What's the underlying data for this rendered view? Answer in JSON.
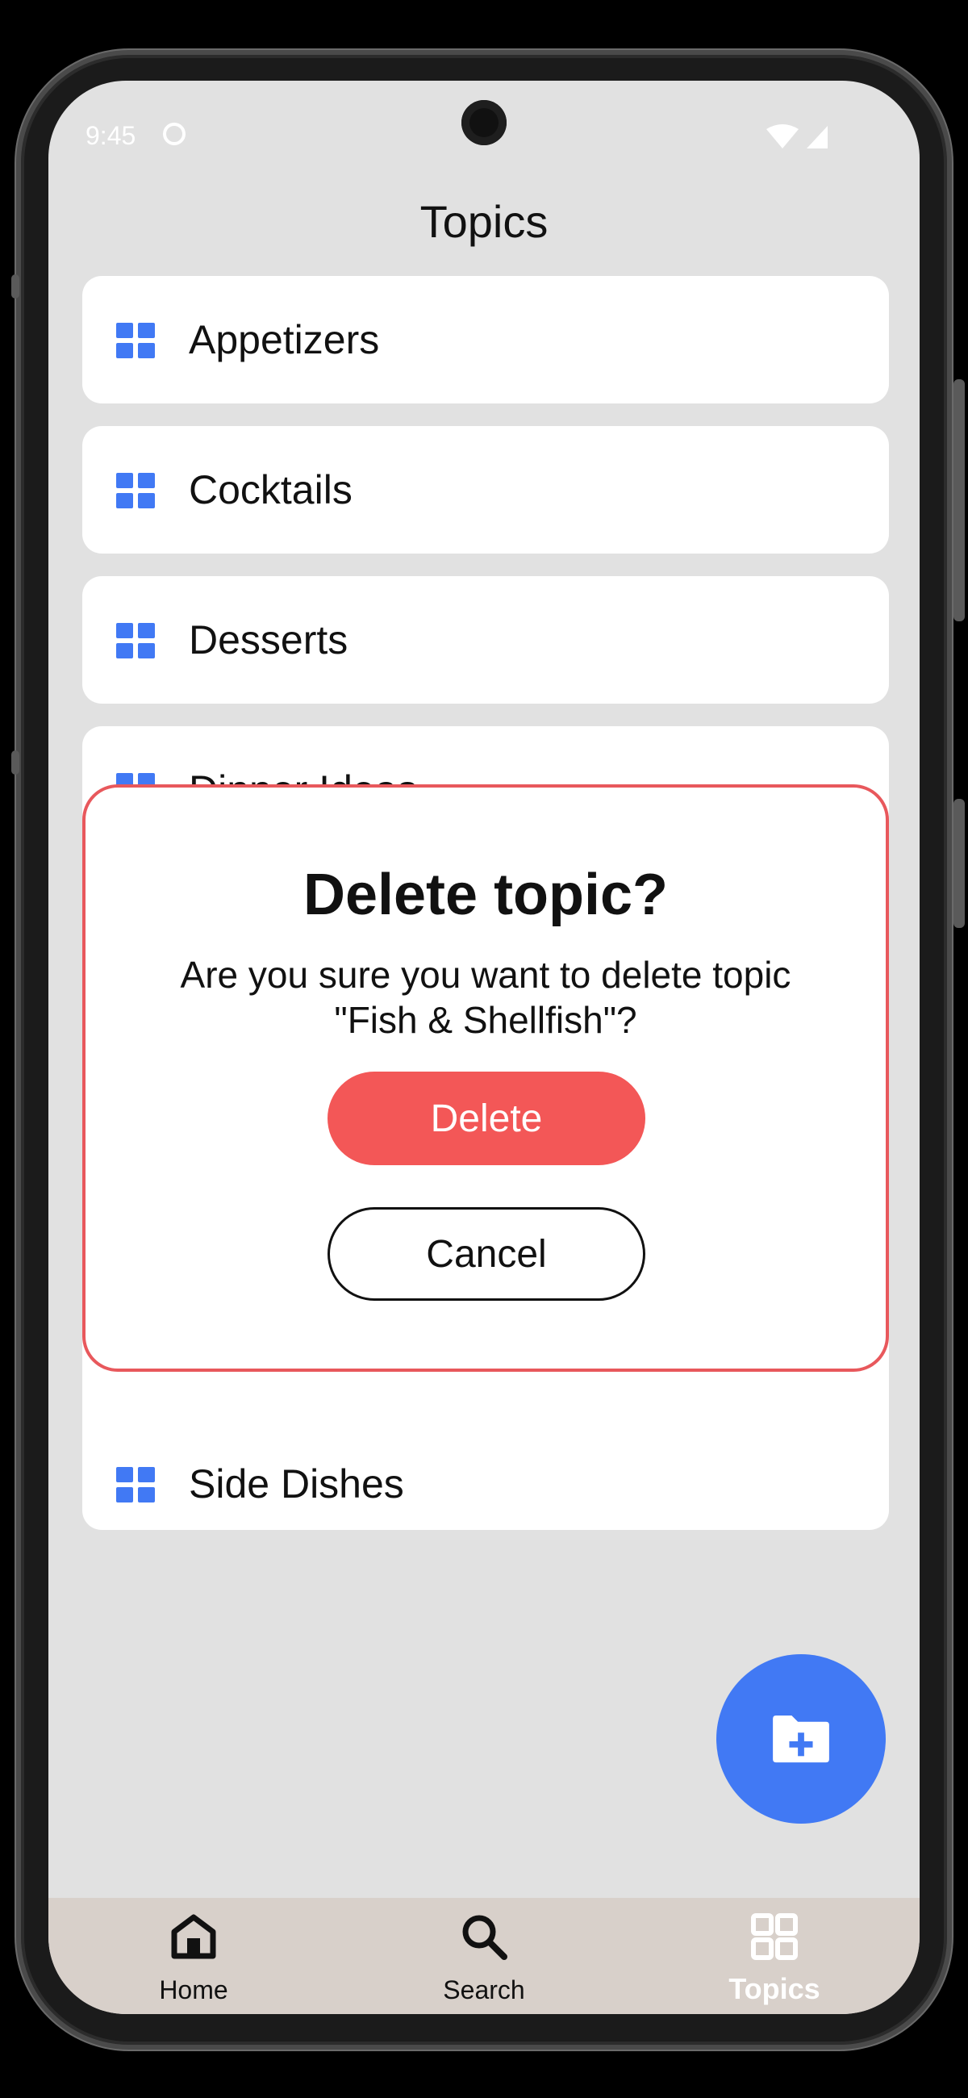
{
  "status_bar": {
    "time": "9:45"
  },
  "header": {
    "title": "Topics"
  },
  "topics": [
    {
      "label": "Appetizers",
      "icon": "grid-icon"
    },
    {
      "label": "Cocktails",
      "icon": "grid-icon"
    },
    {
      "label": "Desserts",
      "icon": "grid-icon"
    },
    {
      "label": "Dinner Ideas",
      "icon": "grid-icon"
    },
    {
      "label": "Side Dishes",
      "icon": "grid-icon"
    }
  ],
  "dialog": {
    "title": "Delete topic?",
    "message": "Are you sure you want to delete topic \"Fish & Shellfish\"?",
    "delete_label": "Delete",
    "cancel_label": "Cancel"
  },
  "fab": {
    "icon": "folder-plus-icon"
  },
  "bottom_nav": {
    "items": [
      {
        "label": "Home",
        "icon": "home-icon"
      },
      {
        "label": "Search",
        "icon": "search-icon"
      },
      {
        "label": "Topics",
        "icon": "grid-icon",
        "active": true
      }
    ]
  },
  "colors": {
    "accent": "#4179f4",
    "danger": "#f35757",
    "background": "#e1e1e1",
    "nav_background": "#d8d0ca"
  }
}
